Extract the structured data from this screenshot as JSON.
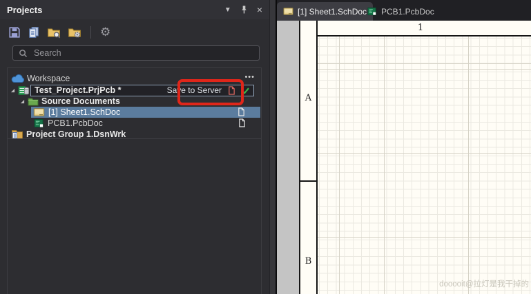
{
  "panel": {
    "title": "Projects",
    "window_controls": {
      "collapse_glyph": "▼",
      "close_glyph": "×"
    },
    "toolbar": {
      "icons": [
        "save",
        "copy-documents",
        "open-project-folder",
        "project-options-folder",
        "settings-gear"
      ]
    },
    "search": {
      "placeholder": "Search"
    },
    "tree": {
      "workspace": {
        "label": "Workspace",
        "menu_glyph": "•••"
      },
      "project": {
        "label": "Test_Project.PrjPcb *",
        "action": "Save to Server"
      },
      "source_folder": {
        "label": "Source Documents"
      },
      "documents": [
        {
          "label": "[1] Sheet1.SchDoc",
          "selected": true
        },
        {
          "label": "PCB1.PcbDoc",
          "selected": false
        }
      ],
      "project_group": {
        "label": "Project Group 1.DsnWrk"
      }
    }
  },
  "editor": {
    "tabs": [
      {
        "label": "[1] Sheet1.SchDoc",
        "active": true
      },
      {
        "label": "PCB1.PcbDoc",
        "active": false
      }
    ],
    "sheet": {
      "zone_top": "1",
      "zone_left_a": "A",
      "zone_left_b": "B",
      "watermark": "dooooit@拉灯是我干掉的"
    }
  },
  "colors": {
    "panel_bg": "#2d2d31",
    "selected_row": "#5b7c9e",
    "annotation_red": "#e0261a",
    "sheet_bg": "#fffdf6",
    "outside_gray": "#c4c4c4",
    "modified_red": "#e06a62",
    "check_green": "#3fae49"
  }
}
